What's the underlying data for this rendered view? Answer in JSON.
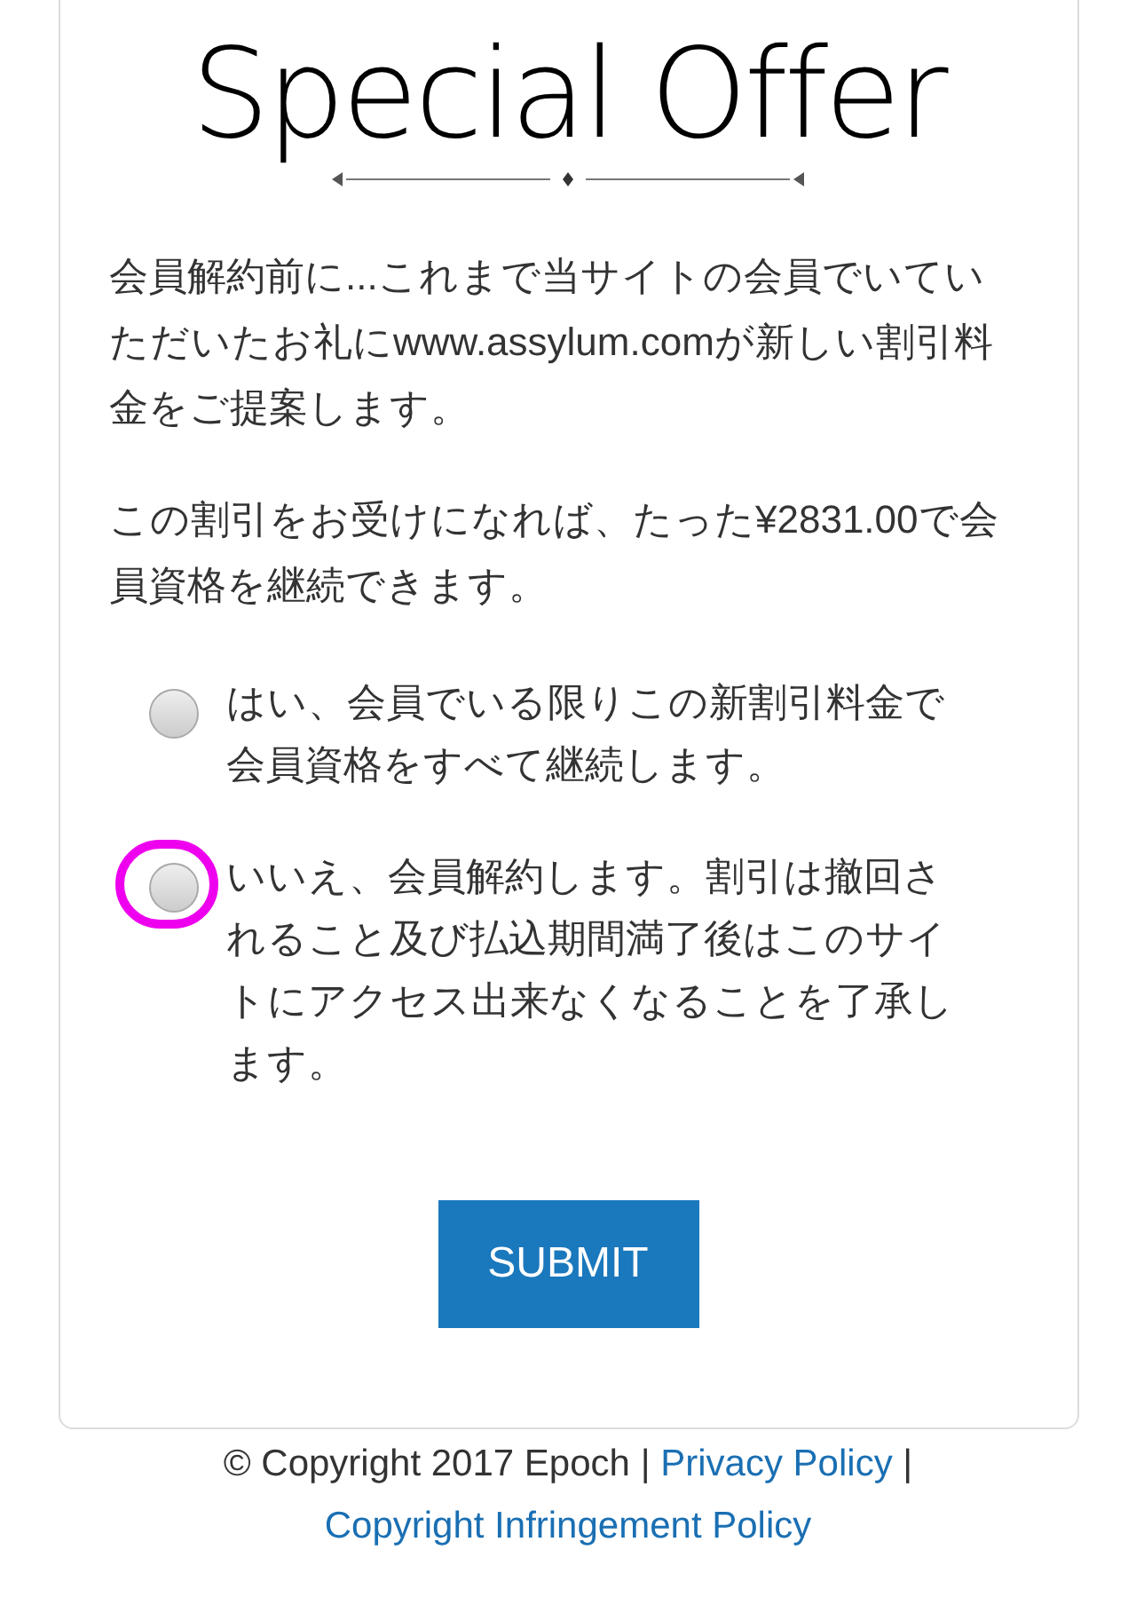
{
  "logo": {
    "text": "Special Offer"
  },
  "paragraphs": [
    "会員解約前に...これまで当サイトの会員でいていただいたお礼にwww.assylum.comが新しい割引料金をご提案します。",
    "この割引をお受けになれば、たった¥2831.00で会員資格を継続できます。"
  ],
  "options": [
    {
      "label": "はい、会員でいる限りこの新割引料金で会員資格をすべて継続します。",
      "selected": false,
      "highlighted": false
    },
    {
      "label": "いいえ、会員解約します。割引は撤回されること及び払込期間満了後はこのサイトにアクセス出来なくなることを了承します。",
      "selected": false,
      "highlighted": true
    }
  ],
  "submit": "SUBMIT",
  "footer": [
    {
      "kind": "text",
      "text": "© Copyright 2017 Epoch"
    },
    {
      "kind": "separator",
      "text": "|"
    },
    {
      "kind": "link",
      "text": "Privacy Policy"
    },
    {
      "kind": "separator",
      "text": "|"
    },
    {
      "kind": "link",
      "text": "Copyright Infringement Policy"
    }
  ]
}
